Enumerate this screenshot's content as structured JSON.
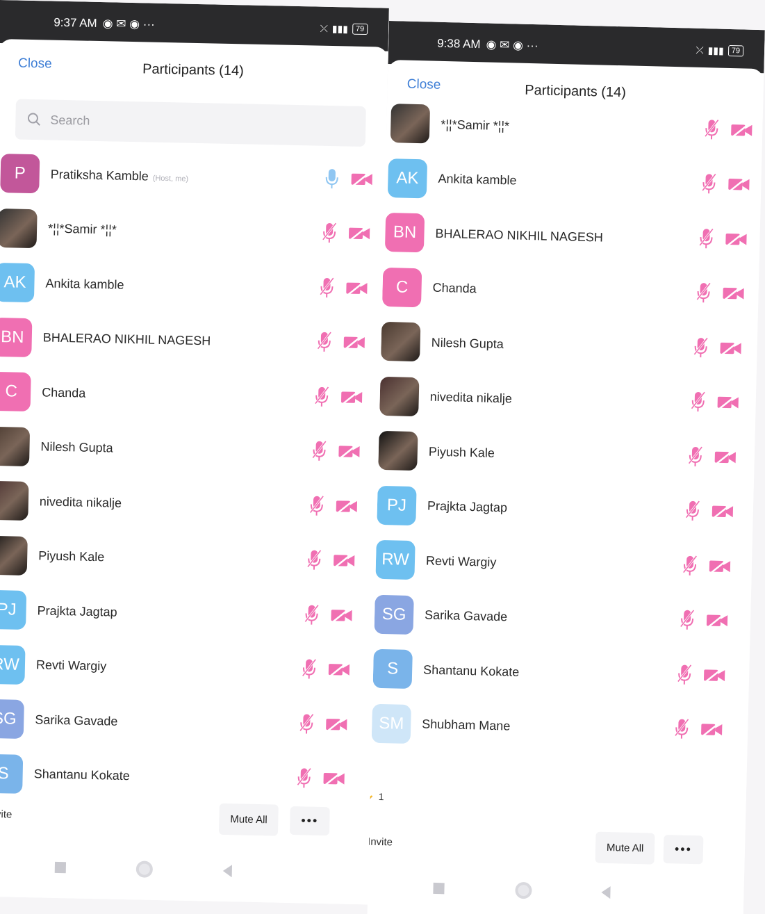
{
  "left": {
    "status_time": "9:37 AM",
    "battery": "79",
    "close_label": "Close",
    "title": "Participants (14)",
    "search_placeholder": "Search",
    "participants": [
      {
        "initials": "P",
        "name": "Pratiksha Kamble",
        "tag": "(Host, me)",
        "color": "#c2579a"
      },
      {
        "initials": "",
        "name": "*¦¦*Samir *¦¦*",
        "color": "#333333"
      },
      {
        "initials": "AK",
        "name": "Ankita kamble",
        "color": "#6ec0f0"
      },
      {
        "initials": "BN",
        "name": "BHALERAO NIKHIL NAGESH",
        "color": "#f06fb2"
      },
      {
        "initials": "C",
        "name": "Chanda",
        "color": "#f06fb2"
      },
      {
        "initials": "",
        "name": "Nilesh Gupta",
        "color": "#4a3a30"
      },
      {
        "initials": "",
        "name": "nivedita nikalje",
        "color": "#4a3030"
      },
      {
        "initials": "",
        "name": "Piyush Kale",
        "color": "#111111"
      },
      {
        "initials": "PJ",
        "name": "Prajkta Jagtap",
        "color": "#6ec0f0"
      },
      {
        "initials": "RW",
        "name": "Revti Wargiy",
        "color": "#6ec0f0"
      },
      {
        "initials": "SG",
        "name": "Sarika Gavade",
        "color": "#8aa6e2"
      },
      {
        "initials": "S",
        "name": "Shantanu Kokate",
        "color": "#7ab4ea"
      }
    ],
    "invite_label": "Invite",
    "mute_all_label": "Mute All",
    "more_label": "•••"
  },
  "right": {
    "status_time": "9:38 AM",
    "battery": "79",
    "close_label": "Close",
    "title": "Participants (14)",
    "participants": [
      {
        "initials": "",
        "name": "*¦¦*Samir *¦¦*",
        "color": "#333333"
      },
      {
        "initials": "AK",
        "name": "Ankita kamble",
        "color": "#6ec0f0"
      },
      {
        "initials": "BN",
        "name": "BHALERAO NIKHIL NAGESH",
        "color": "#f06fb2"
      },
      {
        "initials": "C",
        "name": "Chanda",
        "color": "#f06fb2"
      },
      {
        "initials": "",
        "name": "Nilesh Gupta",
        "color": "#4a3a30"
      },
      {
        "initials": "",
        "name": "nivedita nikalje",
        "color": "#4a3030"
      },
      {
        "initials": "",
        "name": "Piyush Kale",
        "color": "#111111"
      },
      {
        "initials": "PJ",
        "name": "Prajkta Jagtap",
        "color": "#6ec0f0"
      },
      {
        "initials": "RW",
        "name": "Revti Wargiy",
        "color": "#6ec0f0"
      },
      {
        "initials": "SG",
        "name": "Sarika Gavade",
        "color": "#8aa6e2"
      },
      {
        "initials": "S",
        "name": "Shantanu Kokate",
        "color": "#7ab4ea"
      },
      {
        "initials": "SM",
        "name": "Shubham Mane",
        "color": "#cfe6f8"
      }
    ],
    "raised_hand_count": "1",
    "invite_label": "Invite",
    "mute_all_label": "Mute All",
    "more_label": "•••"
  },
  "colors": {
    "accent_pink": "#f06fb2",
    "link_blue": "#3f7fd6",
    "mic_unmuted": "#8fc6f2"
  }
}
